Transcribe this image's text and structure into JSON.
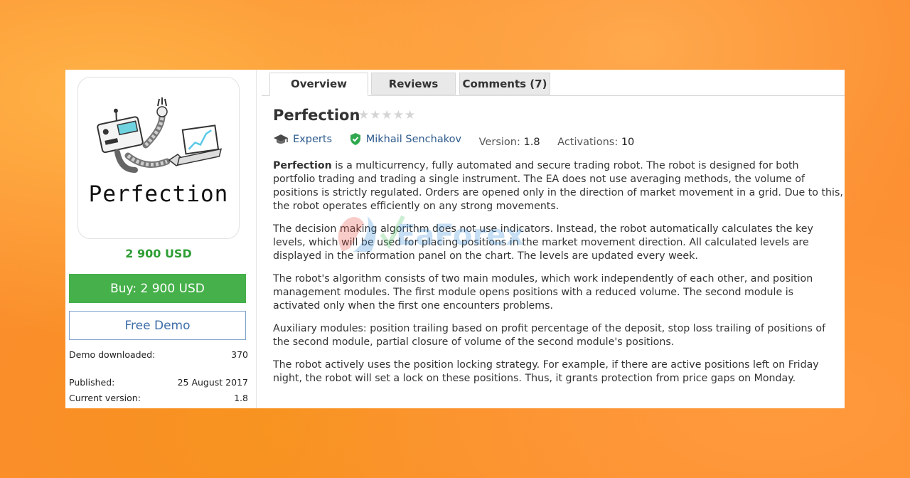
{
  "tabs": [
    {
      "label": "Overview",
      "active": true
    },
    {
      "label": "Reviews",
      "active": false
    },
    {
      "label": "Comments (7)",
      "active": false
    }
  ],
  "product": {
    "logo_text": "Perfection",
    "title": "Perfection",
    "rating_stars": 5,
    "rating_value": 0,
    "price": "2 900 USD",
    "buy_label": "Buy: 2 900 USD",
    "demo_label": "Free Demo"
  },
  "stats": {
    "demo_downloaded_label": "Demo downloaded:",
    "demo_downloaded_value": "370",
    "published_label": "Published:",
    "published_value": "25 August 2017",
    "current_version_label": "Current version:",
    "current_version_value": "1.8"
  },
  "meta": {
    "category": "Experts",
    "author": "Mikhail Senchakov",
    "version_label": "Version:",
    "version_value": "1.8",
    "activations_label": "Activations:",
    "activations_value": "10"
  },
  "description": {
    "p1_bold": "Perfection",
    "p1_rest": " is a multicurrency, fully automated and secure trading robot. The robot is designed for both portfolio trading and trading a single instrument. The EA does not use averaging methods, the volume of positions is strictly regulated. Orders are opened only in the direction of market movement in a grid. Due to this, the robot operates efficiently on any strong movements.",
    "p2": "The decision making algorithm does not use indicators. Instead, the robot automatically calculates the key levels, which will be used for placing positions in the market movement direction. All calculated levels are displayed in the information panel on the chart. The levels are updated every week.",
    "p3": "The robot's algorithm consists of two main modules, which work independently of each other, and position management modules. The first module opens positions with a reduced volume. The second module is activated only when the first one encounters problems.",
    "p4": "Auxiliary modules: position trailing based on profit percentage of the deposit, stop loss trailing of positions of the second module, partial closure of volume of the second module's positions.",
    "p5": "The robot actively uses the position locking strategy. For example, if there are active positions left on Friday night, the robot will set a lock on these positions. Thus, it grants protection from price gaps on Monday."
  },
  "watermark": "EaForex",
  "colors": {
    "accent_green": "#46b04a",
    "price_green": "#2e9e35",
    "link_blue": "#2d5a8c"
  }
}
